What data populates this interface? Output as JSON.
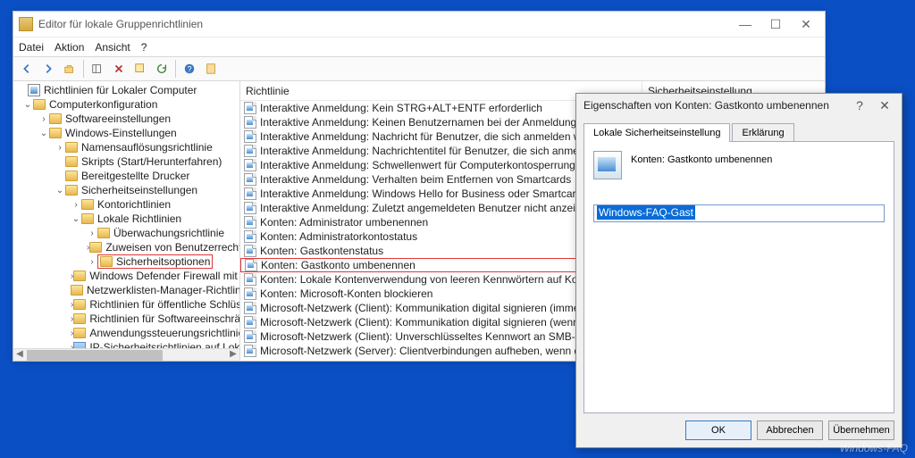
{
  "window": {
    "title": "Editor für lokale Gruppenrichtlinien",
    "menu": {
      "file": "Datei",
      "action": "Aktion",
      "view": "Ansicht",
      "help": "?"
    }
  },
  "tree": {
    "root": "Richtlinien für Lokaler Computer",
    "computer_config": "Computerkonfiguration",
    "software_settings": "Softwareeinstellungen",
    "windows_settings": "Windows-Einstellungen",
    "name_resolution": "Namensauflösungsrichtlinie",
    "scripts": "Skripts (Start/Herunterfahren)",
    "deployed_printers": "Bereitgestellte Drucker",
    "security_settings": "Sicherheitseinstellungen",
    "account_policies": "Kontorichtlinien",
    "local_policies": "Lokale Richtlinien",
    "audit_policy": "Überwachungsrichtlinie",
    "user_rights": "Zuweisen von Benutzerrechten",
    "security_options": "Sicherheitsoptionen",
    "firewall": "Windows Defender Firewall mit erwei",
    "network_list": "Netzwerklisten-Manager-Richtlinien",
    "public_key": "Richtlinien für öffentliche Schlüssel",
    "software_restriction": "Richtlinien für Softwareeinschränkun",
    "app_control": "Anwendungssteuerungsrichtlinien",
    "ip_security": "IP-Sicherheitsrichtlinien auf Lokaler C"
  },
  "list": {
    "col_policy": "Richtlinie",
    "col_security": "Sicherheitseinstellung",
    "items": [
      "Interaktive Anmeldung: Kein STRG+ALT+ENTF erforderlich",
      "Interaktive Anmeldung: Keinen Benutzernamen bei der Anmeldung anzeigen",
      "Interaktive Anmeldung: Nachricht für Benutzer, die sich anmelden wollen",
      "Interaktive Anmeldung: Nachrichtentitel für Benutzer, die sich anmelden wollen",
      "Interaktive Anmeldung: Schwellenwert für Computerkontosperrung",
      "Interaktive Anmeldung: Verhalten beim Entfernen von Smartcards",
      "Interaktive Anmeldung: Windows Hello for Business oder Smartcard erforderlich",
      "Interaktive Anmeldung: Zuletzt angemeldeten Benutzer nicht anzeigen",
      "Konten: Administrator umbenennen",
      "Konten: Administratorkontostatus",
      "Konten: Gastkontenstatus",
      "Konten: Gastkonto umbenennen",
      "Konten: Lokale Kontenverwendung von leeren Kennwörtern auf Konsolenanmeldung beschränken",
      "Konten: Microsoft-Konten blockieren",
      "Microsoft-Netzwerk (Client): Kommunikation digital signieren (immer)",
      "Microsoft-Netzwerk (Client): Kommunikation digital signieren (wenn Server zustimmt)",
      "Microsoft-Netzwerk (Client): Unverschlüsseltes Kennwort an SMB-Server von Drittanbietern senden",
      "Microsoft-Netzwerk (Server): Clientverbindungen aufheben, wenn die Anmeldezeit überschritten w"
    ],
    "highlight_index": 11
  },
  "dialog": {
    "title": "Eigenschaften von Konten: Gastkonto umbenennen",
    "tab_local": "Lokale Sicherheitseinstellung",
    "tab_explain": "Erklärung",
    "label": "Konten: Gastkonto umbenennen",
    "value": "Windows-FAQ-Gast",
    "ok": "OK",
    "cancel": "Abbrechen",
    "apply": "Übernehmen"
  },
  "watermark": "Windows-FAQ"
}
